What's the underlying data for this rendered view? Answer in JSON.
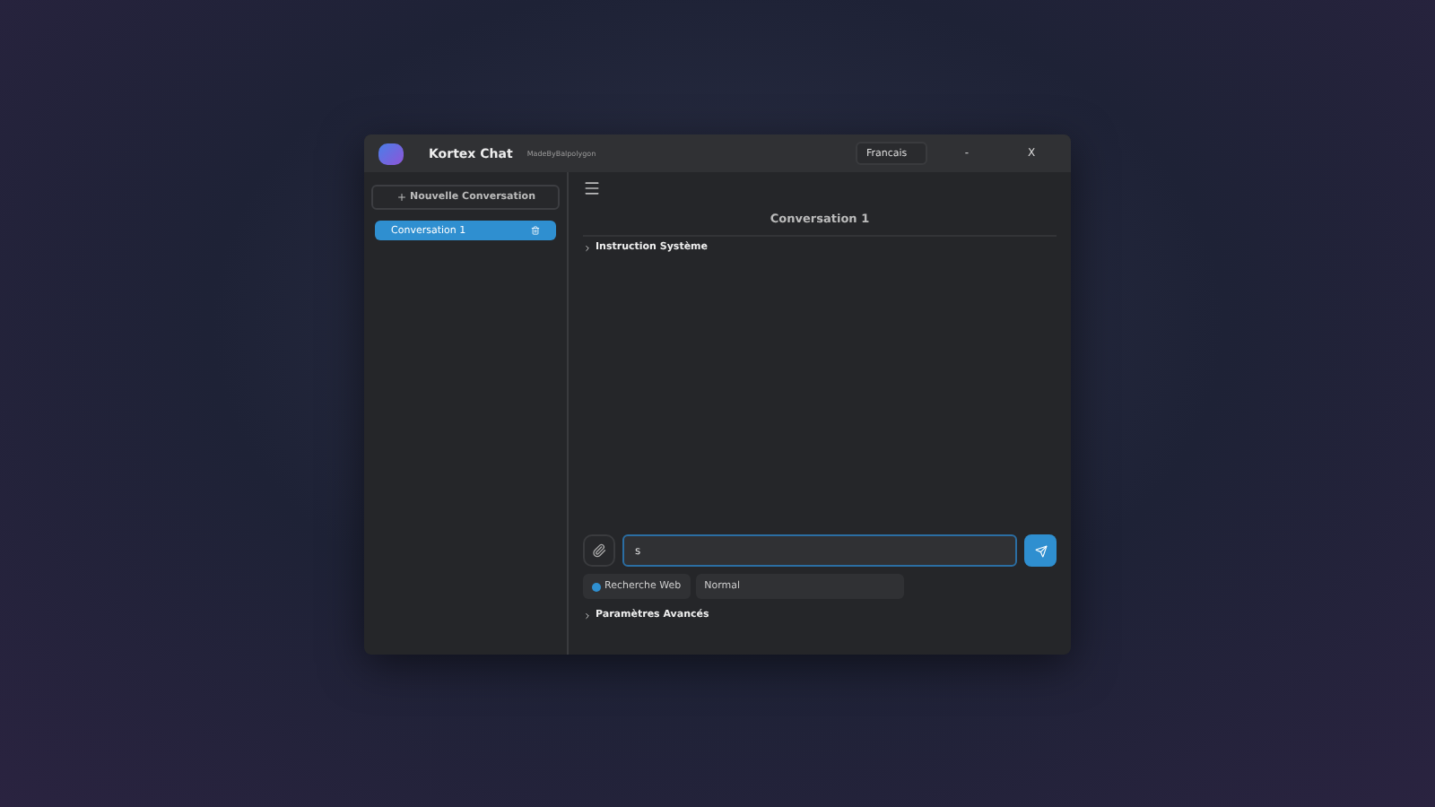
{
  "window": {
    "title": "Kortex Chat",
    "subtitle": "MadeByBalpolygon",
    "language": "Francais",
    "minimize": "-",
    "close": "X"
  },
  "sidebar": {
    "new_button": "Nouvelle Conversation",
    "conversations": [
      {
        "label": "Conversation 1",
        "selected": true
      }
    ]
  },
  "chat": {
    "title": "Conversation 1",
    "system_instruction": {
      "label": "Instruction Système",
      "expanded": false
    }
  },
  "composer": {
    "value": "s",
    "web_search": {
      "label": "Recherche Web",
      "on": true
    },
    "mode": "Normal",
    "advanced": {
      "label": "Paramètres Avancés",
      "expanded": false
    }
  }
}
